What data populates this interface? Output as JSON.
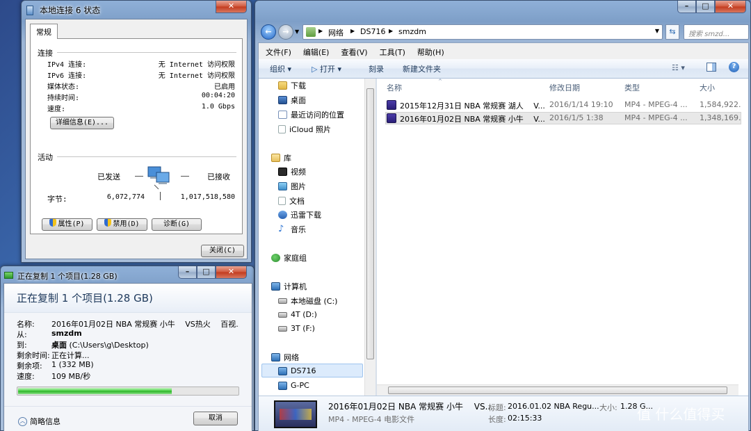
{
  "status_window": {
    "title": "本地连接 6 状态",
    "tab": "常规",
    "connection": {
      "group": "连接",
      "ipv4_label": "IPv4 连接:",
      "ipv4_value": "无 Internet 访问权限",
      "ipv6_label": "IPv6 连接:",
      "ipv6_value": "无 Internet 访问权限",
      "media_label": "媒体状态:",
      "media_value": "已启用",
      "duration_label": "持续时间:",
      "duration_value": "00:04:20",
      "speed_label": "速度:",
      "speed_value": "1.0 Gbps",
      "details_button": "详细信息(E)..."
    },
    "activity": {
      "group": "活动",
      "sent_label": "已发送",
      "received_label": "已接收",
      "bytes_label": "字节:",
      "bytes_sent": "6,072,774",
      "bytes_received": "1,017,518,580"
    },
    "buttons": {
      "properties": "属性(P)",
      "disable": "禁用(D)",
      "diagnose": "诊断(G)",
      "close": "关闭(C)"
    }
  },
  "copy_dialog": {
    "title": "正在复制 1 个项目(1.28 GB)",
    "heading": "正在复制 1 个项目(1.28 GB)",
    "name_label": "名称:",
    "name_value": "2016年01月02日 NBA 常规赛 小牛　 VS热火　 百视...",
    "from_label": "从:",
    "from_value": "smzdm",
    "to_label": "到:",
    "to_value_bold": "桌面",
    "to_value_path": "(C:\\Users\\g\\Desktop)",
    "time_left_label": "剩余时间:",
    "time_left_value": "正在计算...",
    "items_left_label": "剩余项:",
    "items_left_value": "1 (332 MB)",
    "speed_label": "速度:",
    "speed_value": "109 MB/秒",
    "progress": 0.7,
    "less_info": "简略信息",
    "cancel": "取消"
  },
  "explorer": {
    "breadcrumb": [
      "网络",
      "DS716",
      "smzdm"
    ],
    "search_placeholder": "搜索 smzd...",
    "menu": [
      "文件(F)",
      "编辑(E)",
      "查看(V)",
      "工具(T)",
      "帮助(H)"
    ],
    "toolbar": {
      "organize": "组织 ▾",
      "open": "打开 ▾",
      "burn": "刻录",
      "new_folder": "新建文件夹"
    },
    "nav": {
      "downloads": "下载",
      "desktop": "桌面",
      "recent": "最近访问的位置",
      "icloud": "iCloud 照片",
      "libraries": "库",
      "videos": "视频",
      "pictures": "图片",
      "documents": "文档",
      "xunlei": "迅雷下载",
      "music": "音乐",
      "homegroup": "家庭组",
      "computer": "计算机",
      "drive_c": "本地磁盘 (C:)",
      "drive_d": "4T (D:)",
      "drive_f": "3T (F:)",
      "network": "网络",
      "ds716": "DS716",
      "gpc": "G-PC"
    },
    "columns": {
      "name": "名称",
      "date": "修改日期",
      "type": "类型",
      "size": "大小"
    },
    "files": [
      {
        "name": "2015年12月31日 NBA 常规赛 湖人　 V...",
        "date": "2016/1/14 19:10",
        "type": "MP4 - MPEG-4 ...",
        "size": "1,584,922..."
      },
      {
        "name": "2016年01月02日 NBA 常规赛 小牛　 V...",
        "date": "2016/1/5 1:38",
        "type": "MP4 - MPEG-4 ...",
        "size": "1,348,169..."
      }
    ],
    "details": {
      "name": "2016年01月02日 NBA 常规赛 小牛　 VS...",
      "type": "MP4 - MPEG-4 电影文件",
      "title_label": "标题:",
      "title_value": "2016.01.02 NBA Regu...",
      "length_label": "长度:",
      "length_value": "02:15:33",
      "size_label": "大小:",
      "size_value": "1.28 G..."
    }
  },
  "watermark": "值 什么值得买",
  "colors": {
    "progress_green": "#2fb42a",
    "aero_title": "#8fb0d8",
    "selection": "#e5f3fb"
  }
}
